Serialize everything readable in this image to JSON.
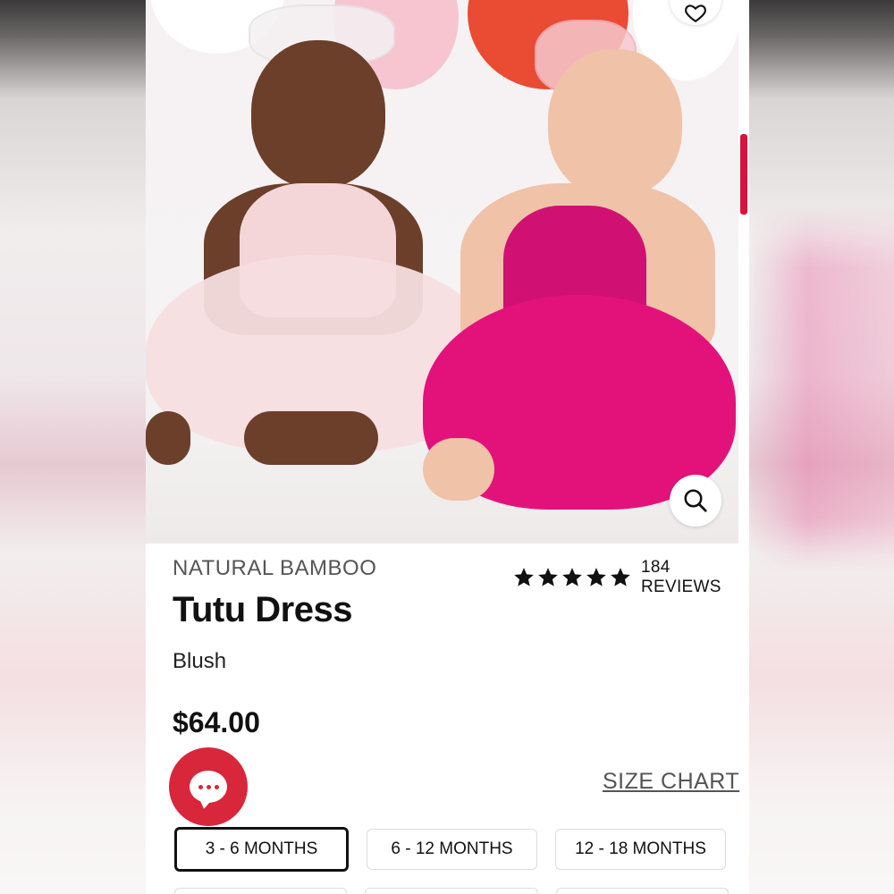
{
  "product": {
    "brand": "NATURAL BAMBOO",
    "title": "Tutu Dress",
    "color": "Blush",
    "price": "$64.00"
  },
  "rating": {
    "stars": 5,
    "reviews_label": "184 REVIEWS"
  },
  "links": {
    "size_chart": "SIZE CHART"
  },
  "sizes": [
    {
      "label": "3 - 6 MONTHS",
      "selected": true
    },
    {
      "label": "6 - 12 MONTHS",
      "selected": false
    },
    {
      "label": "12 - 18 MONTHS",
      "selected": false
    }
  ],
  "icons": {
    "zoom": "magnifier-icon",
    "wishlist": "heart-icon",
    "chat": "chat-bubble-icon",
    "star": "star-icon"
  },
  "colors": {
    "accent_red": "#d8263b",
    "text": "#111111",
    "muted": "#555555",
    "blush_dress": "#f4d3d6",
    "pink_dress": "#e3127a"
  }
}
